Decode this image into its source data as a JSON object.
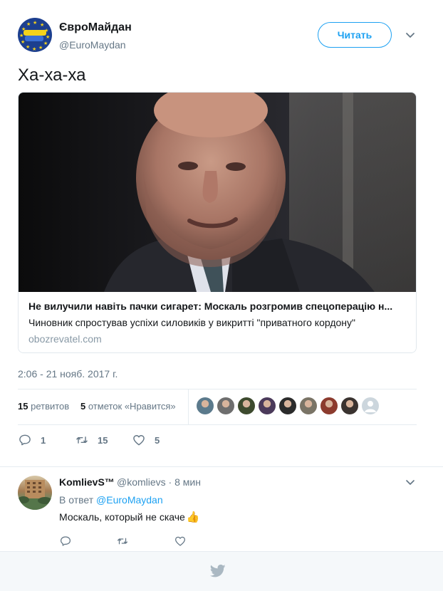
{
  "tweet": {
    "author_name": "ЄвроМайдан",
    "author_handle": "@EuroMaydan",
    "follow_label": "Читать",
    "text": "Ха-ха-ха",
    "timestamp": "2:06 - 21 нояб. 2017 г.",
    "card": {
      "title": "Не вилучили навіть пачки сигарет: Москаль розгромив спецоперацію н...",
      "description": "Чиновник спростував успіхи силовиків у викритті \"приватного кордону\"",
      "domain": "obozrevatel.com"
    },
    "stats": {
      "retweets_count": "15",
      "retweets_label": "ретвитов",
      "likes_count": "5",
      "likes_label": "отметок «Нравится»"
    },
    "actions": {
      "reply_count": "1",
      "retweet_count": "15",
      "like_count": "5"
    }
  },
  "liker_avatars": [
    {
      "color": "#5b7a8c"
    },
    {
      "color": "#6e6e6e"
    },
    {
      "color": "#3d4a2e"
    },
    {
      "color": "#4b3a5a"
    },
    {
      "color": "#2b2b2b"
    },
    {
      "color": "#7a7466"
    },
    {
      "color": "#8c3b2e"
    },
    {
      "color": "#3a3330"
    },
    {
      "color": "#ccd6dd"
    }
  ],
  "reply": {
    "name": "KomlievS™",
    "handle_time": "@komlievs · 8 мин",
    "in_reply_to_label": "В ответ",
    "in_reply_to_handle": "@EuroMaydan",
    "text": "Москаль, который не скаче",
    "emoji": "👍"
  },
  "colors": {
    "accent": "#1da1f2",
    "secondary_text": "#657786",
    "border": "#e6ecf0"
  }
}
